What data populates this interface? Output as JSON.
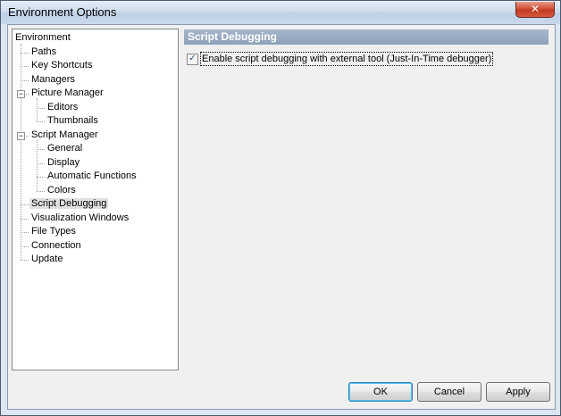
{
  "window": {
    "title": "Environment Options",
    "close_glyph": "✕"
  },
  "tree": {
    "items": [
      {
        "label": "Environment",
        "level": 0,
        "expander": ""
      },
      {
        "label": "Paths",
        "level": 1,
        "expander": ""
      },
      {
        "label": "Key Shortcuts",
        "level": 1,
        "expander": ""
      },
      {
        "label": "Managers",
        "level": 1,
        "expander": ""
      },
      {
        "label": "Picture Manager",
        "level": 1,
        "expander": "−"
      },
      {
        "label": "Editors",
        "level": 2,
        "expander": ""
      },
      {
        "label": "Thumbnails",
        "level": 2,
        "expander": ""
      },
      {
        "label": "Script Manager",
        "level": 1,
        "expander": "−"
      },
      {
        "label": "General",
        "level": 2,
        "expander": ""
      },
      {
        "label": "Display",
        "level": 2,
        "expander": ""
      },
      {
        "label": "Automatic Functions",
        "level": 2,
        "expander": ""
      },
      {
        "label": "Colors",
        "level": 2,
        "expander": ""
      },
      {
        "label": "Script Debugging",
        "level": 1,
        "expander": "",
        "selected": true
      },
      {
        "label": "Visualization Windows",
        "level": 1,
        "expander": ""
      },
      {
        "label": "File Types",
        "level": 1,
        "expander": ""
      },
      {
        "label": "Connection",
        "level": 1,
        "expander": ""
      },
      {
        "label": "Update",
        "level": 1,
        "expander": ""
      }
    ]
  },
  "panel": {
    "header": "Script Debugging",
    "checkbox_label": "Enable script debugging with external tool (Just-In-Time debugger)",
    "checkbox_checked": true,
    "check_glyph": "✓"
  },
  "buttons": {
    "ok": "OK",
    "cancel": "Cancel",
    "apply": "Apply"
  }
}
